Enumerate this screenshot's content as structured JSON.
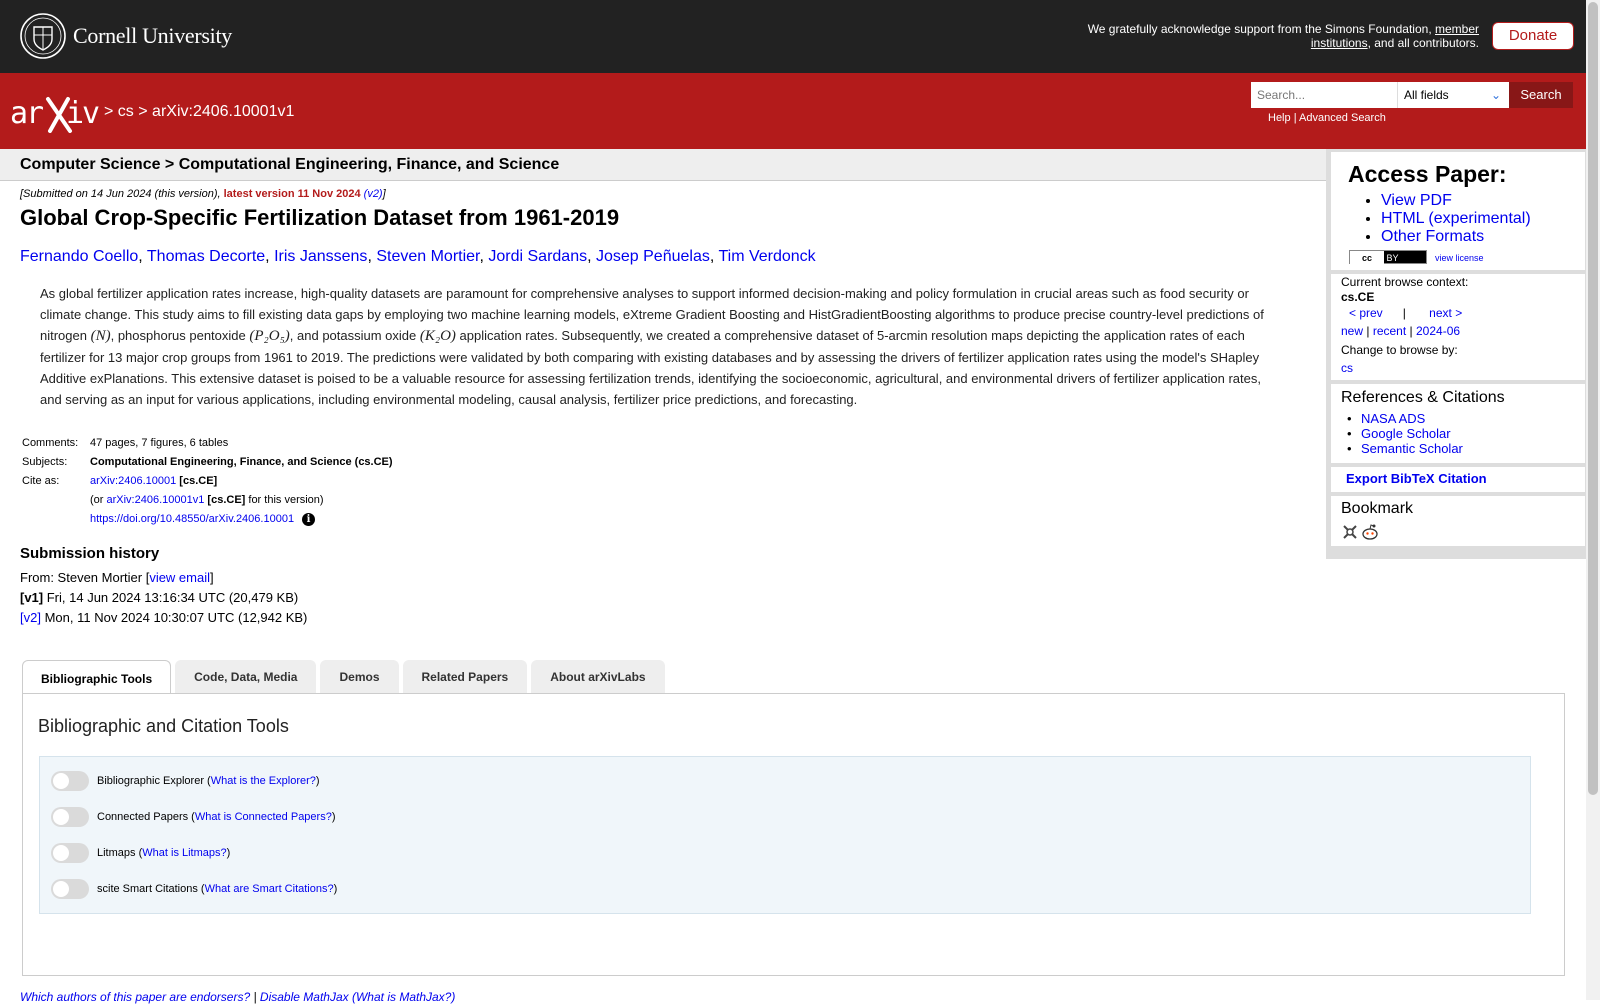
{
  "topbar": {
    "institution": "Cornell University",
    "support_prefix": "We gratefully acknowledge support from the Simons Foundation, ",
    "support_link": "member institutions",
    "support_suffix": ", and all contributors.",
    "donate_label": "Donate"
  },
  "header": {
    "breadcrumb_sep1": ">",
    "breadcrumb_cs": "cs",
    "breadcrumb_sep2": ">",
    "breadcrumb_id": "arXiv:2406.10001v1",
    "search_placeholder": "Search...",
    "field_selected": "All fields",
    "search_button": "Search",
    "help_label": "Help",
    "help_sep": "|",
    "advanced_label": "Advanced Search"
  },
  "main": {
    "subject_header": "Computer Science > Computational Engineering, Finance, and Science",
    "submitted": "[Submitted on 14 Jun 2024 (this version), ",
    "latest_version": "latest version 11 Nov 2024",
    "latest_link": "(v2)",
    "submitted_close": "]",
    "title": "Global Crop-Specific Fertilization Dataset from 1961-2019",
    "authors": [
      "Fernando Coello",
      "Thomas Decorte",
      "Iris Janssens",
      "Steven Mortier",
      "Jordi Sardans",
      "Josep Peñuelas",
      "Tim Verdonck"
    ],
    "abstract_part1": "As global fertilizer application rates increase, high-quality datasets are paramount for comprehensive analyses to support informed decision-making and policy formulation in crucial areas such as food security or climate change. This study aims to fill existing data gaps by employing two machine learning models, eXtreme Gradient Boosting and HistGradientBoosting algorithms to produce precise country-level predictions of nitrogen ",
    "abstract_math_n": "(N)",
    "abstract_part2": ", phosphorus pentoxide ",
    "abstract_math_p": "(P₂O₅)",
    "abstract_part3": ", and potassium oxide ",
    "abstract_math_k": "(K₂O)",
    "abstract_part4": " application rates. Subsequently, we created a comprehensive dataset of 5-arcmin resolution maps depicting the application rates of each fertilizer for 13 major crop groups from 1961 to 2019. The predictions were validated by both comparing with existing databases and by assessing the drivers of fertilizer application rates using the model's SHapley Additive exPlanations. This extensive dataset is poised to be a valuable resource for assessing fertilization trends, identifying the socioeconomic, agricultural, and environmental drivers of fertilizer application rates, and serving as an input for various applications, including environmental modeling, causal analysis, fertilizer price predictions, and forecasting.",
    "meta": {
      "comments_label": "Comments:",
      "comments_value": "47 pages, 7 figures, 6 tables",
      "subjects_label": "Subjects:",
      "subjects_value": "Computational Engineering, Finance, and Science (cs.CE)",
      "cite_label": "Cite as:",
      "cite_link": "arXiv:2406.10001",
      "cite_tag": "[cs.CE]",
      "cite_or_prefix": "(or ",
      "cite_version_link": "arXiv:2406.10001v1",
      "cite_version_tag": "[cs.CE]",
      "cite_version_suffix": " for this version)",
      "doi": "https://doi.org/10.48550/arXiv.2406.10001",
      "info_icon": "i"
    },
    "submission_history": {
      "title": "Submission history",
      "from_prefix": "From: Steven Mortier [",
      "view_email": "view email",
      "from_suffix": "]",
      "v1_label": "[v1]",
      "v1_text": " Fri, 14 Jun 2024 13:16:34 UTC (20,479 KB)",
      "v2_label": "[v2]",
      "v2_text": " Mon, 11 Nov 2024 10:30:07 UTC (12,942 KB)"
    },
    "tabs": [
      {
        "label": "Bibliographic Tools"
      },
      {
        "label": "Code, Data, Media"
      },
      {
        "label": "Demos"
      },
      {
        "label": "Related Papers"
      },
      {
        "label": "About arXivLabs"
      }
    ],
    "panel_title": "Bibliographic and Citation Tools",
    "tools": [
      {
        "name": "Bibliographic Explorer",
        "link": "What is the Explorer?"
      },
      {
        "name": "Connected Papers",
        "link": "What is Connected Papers?"
      },
      {
        "name": "Litmaps",
        "link": "What is Litmaps?"
      },
      {
        "name": "scite Smart Citations",
        "link": "What are Smart Citations?"
      }
    ],
    "footer_endorsers": "Which authors of this paper are endorsers?",
    "footer_sep": " | ",
    "footer_mathjax": "Disable MathJax",
    "footer_whatmathjax": "(What is MathJax?)"
  },
  "sidebar": {
    "access_title": "Access Paper:",
    "access_links": [
      "View PDF",
      "HTML (experimental)",
      "Other Formats"
    ],
    "cc_label": "cc",
    "cc_by": "BY",
    "view_license": "view license",
    "browse_context_label": "Current browse context:",
    "browse_context_value": "cs.CE",
    "prev": "< prev",
    "pipe": "|",
    "next": "next >",
    "new": "new",
    "recent": "recent",
    "month": "2024-06",
    "change_browse_label": "Change to browse by:",
    "browse_cs": "cs",
    "refs_title": "References & Citations",
    "refs_links": [
      "NASA ADS",
      "Google Scholar",
      "Semantic Scholar"
    ],
    "bibtex": "Export BibTeX Citation",
    "bookmark_title": "Bookmark"
  }
}
